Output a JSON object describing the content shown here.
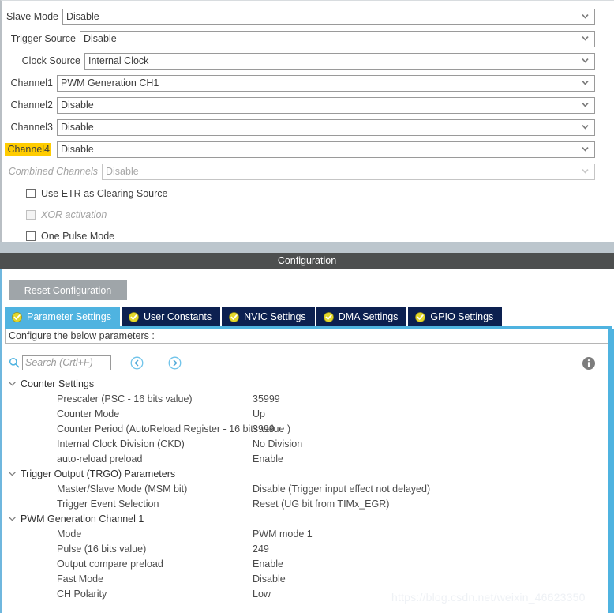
{
  "mode_panel": {
    "rows": [
      {
        "label": "Slave Mode",
        "value": "Disable",
        "label_w": 77,
        "disabled": false,
        "highlight": false
      },
      {
        "label": "Trigger Source",
        "value": "Disable",
        "label_w": 99,
        "disabled": false,
        "highlight": false
      },
      {
        "label": "Clock Source",
        "value": "Internal Clock",
        "label_w": 105,
        "disabled": false,
        "highlight": false
      },
      {
        "label": "Channel1",
        "value": "PWM Generation CH1",
        "label_w": 70,
        "disabled": false,
        "highlight": false
      },
      {
        "label": "Channel2",
        "value": "Disable",
        "label_w": 70,
        "disabled": false,
        "highlight": false
      },
      {
        "label": "Channel3",
        "value": "Disable",
        "label_w": 70,
        "disabled": false,
        "highlight": false
      },
      {
        "label": "Channel4",
        "value": "Disable",
        "label_w": 70,
        "disabled": false,
        "highlight": true
      },
      {
        "label": "Combined Channels",
        "value": "Disable",
        "label_w": 127,
        "disabled": true,
        "highlight": false
      }
    ],
    "checkboxes": [
      {
        "label": "Use ETR as Clearing Source",
        "checked": false,
        "disabled": false
      },
      {
        "label": "XOR activation",
        "checked": false,
        "disabled": true
      },
      {
        "label": "One Pulse Mode",
        "checked": false,
        "disabled": false
      }
    ]
  },
  "configuration": {
    "title": "Configuration",
    "reset_button": "Reset Configuration",
    "tabs": [
      {
        "label": "Parameter Settings",
        "active": true
      },
      {
        "label": "User Constants",
        "active": false
      },
      {
        "label": "NVIC Settings",
        "active": false
      },
      {
        "label": "DMA Settings",
        "active": false
      },
      {
        "label": "GPIO Settings",
        "active": false
      }
    ],
    "configure_note": "Configure the below parameters :",
    "search": {
      "value": "",
      "placeholder": "Search (Crtl+F)"
    },
    "tree": [
      {
        "group": "Counter Settings",
        "expanded": true,
        "params": [
          {
            "name": "Prescaler (PSC - 16 bits value)",
            "value": "35999"
          },
          {
            "name": "Counter Mode",
            "value": "Up"
          },
          {
            "name": "Counter Period (AutoReload Register - 16 bits value )",
            "value": "3999"
          },
          {
            "name": "Internal Clock Division (CKD)",
            "value": "No Division"
          },
          {
            "name": "auto-reload preload",
            "value": "Enable"
          }
        ]
      },
      {
        "group": "Trigger Output (TRGO) Parameters",
        "expanded": true,
        "params": [
          {
            "name": "Master/Slave Mode (MSM bit)",
            "value": "Disable (Trigger input effect not delayed)"
          },
          {
            "name": "Trigger Event Selection",
            "value": "Reset (UG bit from TIMx_EGR)"
          }
        ]
      },
      {
        "group": "PWM Generation Channel 1",
        "expanded": true,
        "params": [
          {
            "name": "Mode",
            "value": "PWM mode 1"
          },
          {
            "name": "Pulse (16 bits value)",
            "value": "249"
          },
          {
            "name": "Output compare preload",
            "value": "Enable"
          },
          {
            "name": "Fast Mode",
            "value": "Disable"
          },
          {
            "name": "CH Polarity",
            "value": "Low"
          }
        ]
      }
    ]
  },
  "watermark": "https://blog.csdn.net/weixin_46623350",
  "colors": {
    "accent_blue": "#4fb3e0",
    "tab_navy": "#0c2050",
    "title_bar": "#4d4f4f",
    "highlight_yellow": "#ffcc00",
    "reset_button": "#9fa5a9"
  }
}
